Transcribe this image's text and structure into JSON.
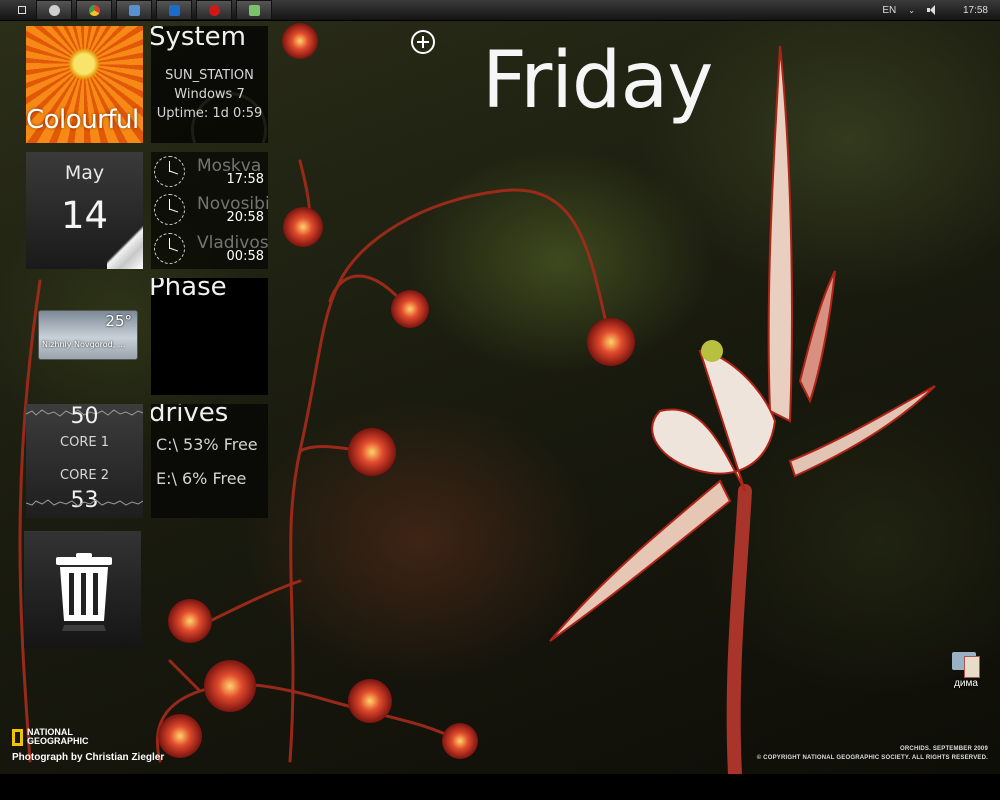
{
  "taskbar": {
    "apps": [
      {
        "name": "media-player-icon",
        "color": "#cfcfcf"
      },
      {
        "name": "chrome-icon",
        "color": "#e8b020"
      },
      {
        "name": "explorer-icon",
        "color": "#5a8fd0"
      },
      {
        "name": "photoshop-icon",
        "color": "#1c6cc8"
      },
      {
        "name": "opera-icon",
        "color": "#d01818"
      },
      {
        "name": "notes-icon",
        "color": "#7cc26a"
      }
    ],
    "lang": "EN",
    "clock": "17:58"
  },
  "heading": {
    "day_name": "Friday"
  },
  "tiles": {
    "colourful": {
      "label": "Colourful"
    },
    "system": {
      "title": "System",
      "computer": "SUN_STATION",
      "os": "Windows 7",
      "uptime": "Uptime: 1d 0:59"
    },
    "calendar": {
      "month": "May",
      "day": "14"
    },
    "clocks": [
      {
        "city": "Moskva",
        "time": "17:58"
      },
      {
        "city": "Novosibirsk",
        "time": "20:58"
      },
      {
        "city": "Vladivostok",
        "time": "00:58"
      }
    ],
    "weather": {
      "temp": "25°",
      "location": "Nizhniy Novgorod, ..."
    },
    "phase": {
      "title": "Phase"
    },
    "cpu": {
      "core1_value": "50",
      "core1_label": "CORE 1",
      "core2_label": "CORE 2",
      "core2_value": "53"
    },
    "drives": {
      "title": "drives",
      "items": [
        "C:\\ 53% Free",
        "E:\\ 6% Free"
      ]
    },
    "recycle": {
      "icon": "trash-icon"
    }
  },
  "wallpaper": {
    "logo_line1": "NATIONAL",
    "logo_line2": "GEOGRAPHIC",
    "credit": "Photograph by Christian Ziegler",
    "caption": "ORCHIDS. SEPTEMBER 2009",
    "copyright": "© COPYRIGHT NATIONAL GEOGRAPHIC SOCIETY. ALL RIGHTS RESERVED."
  },
  "desktop_icons": [
    {
      "label": "дима"
    }
  ],
  "colors": {
    "tile_dark": "#1a1a1a",
    "ng_yellow": "#f2c400",
    "flower_red": "#c0201c"
  }
}
